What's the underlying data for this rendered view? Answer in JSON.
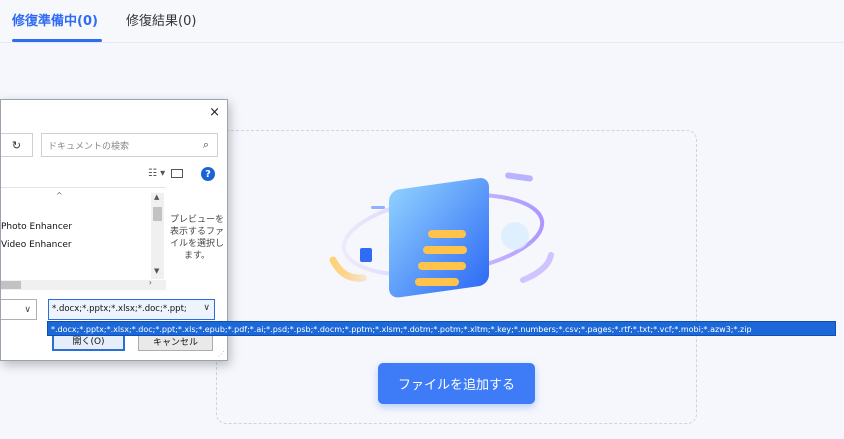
{
  "tabs": [
    {
      "label": "修復準備中(0)",
      "active": true
    },
    {
      "label": "修復結果(0)",
      "active": false
    }
  ],
  "colors": {
    "accent": "#2f6bf5",
    "button": "#3d7bf7",
    "dropdown_highlight": "#1c68d8"
  },
  "dropzone": {
    "add_button_label": "ファイルを追加する"
  },
  "file_dialog": {
    "close_glyph": "×",
    "refresh_glyph": "↻",
    "search_placeholder": "ドキュメントの検索",
    "search_icon_glyph": "⌕",
    "view_glyph": "☷ ▾",
    "help_glyph": "?",
    "collapse_glyph": "^",
    "items": [
      "Photo Enhancer",
      "Video Enhancer"
    ],
    "preview_text": "プレビューを表示するファイルを選択します。",
    "filename_caret": "∨",
    "file_type_value": "*.docx;*.pptx;*.xlsx;*.doc;*.ppt;",
    "file_type_caret": "∨",
    "open_label": "開く(O)",
    "cancel_label": "キャンセル"
  },
  "file_type_dropdown": {
    "option": "*.docx;*.pptx;*.xlsx;*.doc;*.ppt;*.xls;*.epub;*.pdf;*.ai;*.psd;*.psb;*.docm;*.pptm;*.xlsm;*.dotm;*.potm;*.xltm;*.key;*.numbers;*.csv;*.pages;*.rtf;*.txt;*.vcf;*.mobi;*.azw3;*.zip"
  }
}
